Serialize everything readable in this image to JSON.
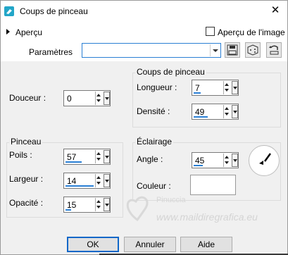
{
  "window": {
    "title": "Coups de pinceau",
    "close": "✕"
  },
  "preview": {
    "label": "Aperçu",
    "image_preview_label": "Aperçu de l'image",
    "image_preview_checked": false
  },
  "params": {
    "label": "Paramètres",
    "preset_value": ""
  },
  "softness": {
    "label": "Douceur :",
    "value": "0"
  },
  "brushstrokes_group": {
    "title": "Coups de pinceau",
    "length_label": "Longueur :",
    "length_value": "7",
    "density_label": "Densité :",
    "density_value": "49"
  },
  "brush_group": {
    "title": "Pinceau",
    "bristles_label": "Poils :",
    "bristles_value": "57",
    "width_label": "Largeur :",
    "width_value": "14",
    "opacity_label": "Opacité :",
    "opacity_value": "15"
  },
  "lighting_group": {
    "title": "Éclairage",
    "angle_label": "Angle :",
    "angle_value": "45",
    "color_label": "Couleur :",
    "color_hex": "#ffffff"
  },
  "watermark": {
    "name": "Pinuccia",
    "url": "www.maildiregrafica.eu"
  },
  "buttons": {
    "ok": "OK",
    "cancel": "Annuler",
    "help": "Aide"
  }
}
